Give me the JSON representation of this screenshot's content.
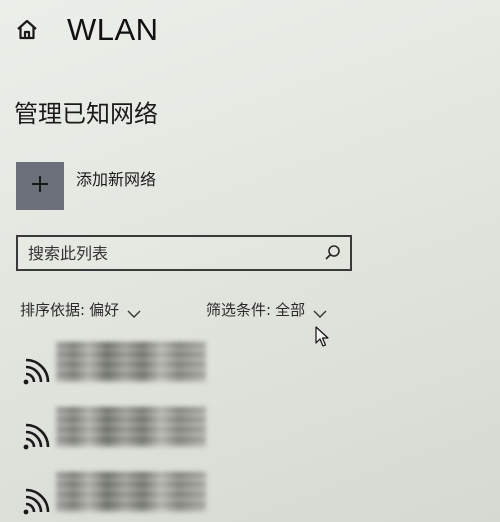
{
  "header": {
    "title": "WLAN",
    "home_icon": "home-icon"
  },
  "section": {
    "title": "管理已知网络"
  },
  "add_network": {
    "label": "添加新网络",
    "tile_color": "#6a6f79"
  },
  "search": {
    "placeholder": "搜索此列表",
    "icon": "search-icon"
  },
  "sort": {
    "label": "排序依据:",
    "value": "偏好"
  },
  "filter": {
    "label": "筛选条件:",
    "value": "全部"
  },
  "networks": [
    {
      "icon": "wifi-icon"
    },
    {
      "icon": "wifi-icon"
    },
    {
      "icon": "wifi-icon"
    }
  ]
}
